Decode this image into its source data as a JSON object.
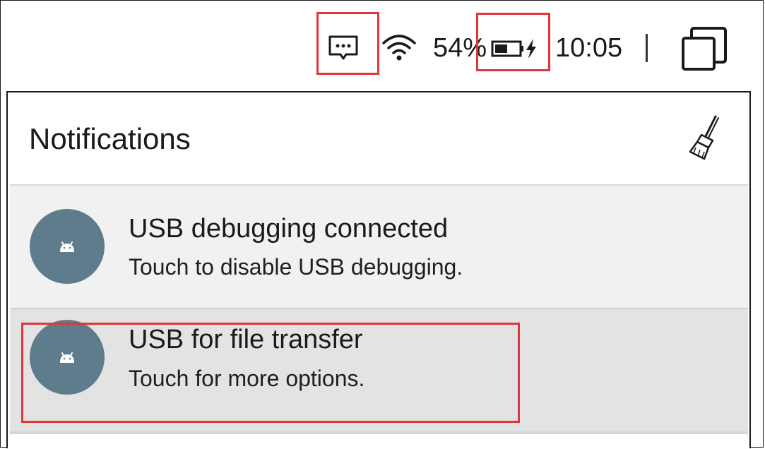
{
  "status_bar": {
    "message_icon": "message-icon",
    "wifi_icon": "wifi-icon",
    "battery_percent": "54%",
    "battery_icon": "battery-charging-icon",
    "time": "10:05",
    "recents_icon": "recents-icon"
  },
  "panel": {
    "title": "Notifications",
    "clear_icon": "broom-icon"
  },
  "notifications": [
    {
      "title": "USB debugging connected",
      "subtitle": "Touch to disable USB debugging.",
      "icon": "android-icon"
    },
    {
      "title": "USB for file transfer",
      "subtitle": "Touch for more options.",
      "icon": "android-icon"
    }
  ],
  "colors": {
    "highlight": "#e0353b",
    "avatar": "#5e7c8c",
    "row1_bg": "#f1f1f1",
    "row2_bg": "#e3e3e3"
  }
}
